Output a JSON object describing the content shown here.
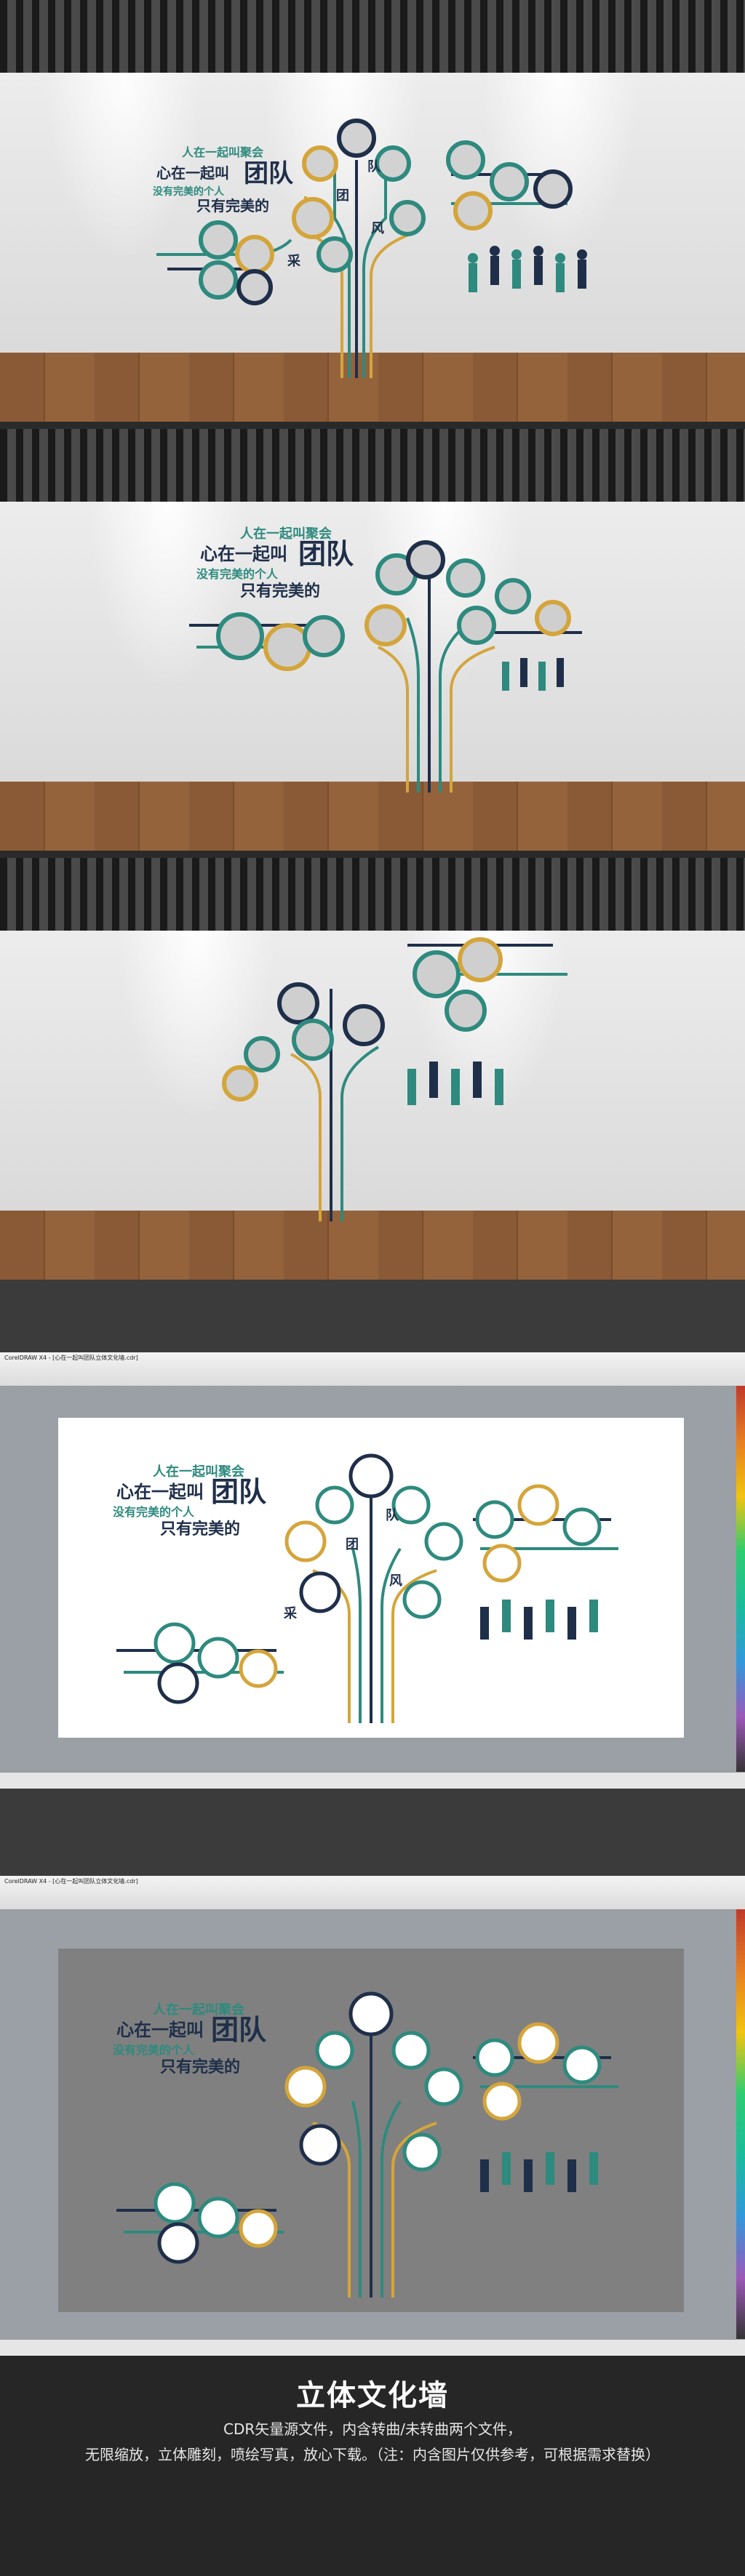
{
  "wall_design": {
    "slogan_small": "人在一起叫聚会",
    "slogan_main": "心在一起叫",
    "slogan_big": "团队",
    "slogan_line2": "没有完美的个人",
    "slogan_line3": "只有完美的",
    "tree_chars": [
      "团",
      "队",
      "风",
      "采"
    ]
  },
  "cdr_window": {
    "title": "CorelDRAW X4 - [心在一起叫团队立体文化墙.cdr]"
  },
  "footer": {
    "title": "立体文化墙",
    "line1": "CDR矢量源文件，内含转曲/未转曲两个文件，",
    "line2": "无限缩放，立体雕刻，喷绘写真，放心下载。（注：内含图片仅供参考，可根据需求替换）"
  },
  "colors": {
    "teal": "#2e8a7e",
    "navy": "#1f2f4a",
    "gold": "#d4a53b",
    "wall": "#e8e8e8"
  }
}
